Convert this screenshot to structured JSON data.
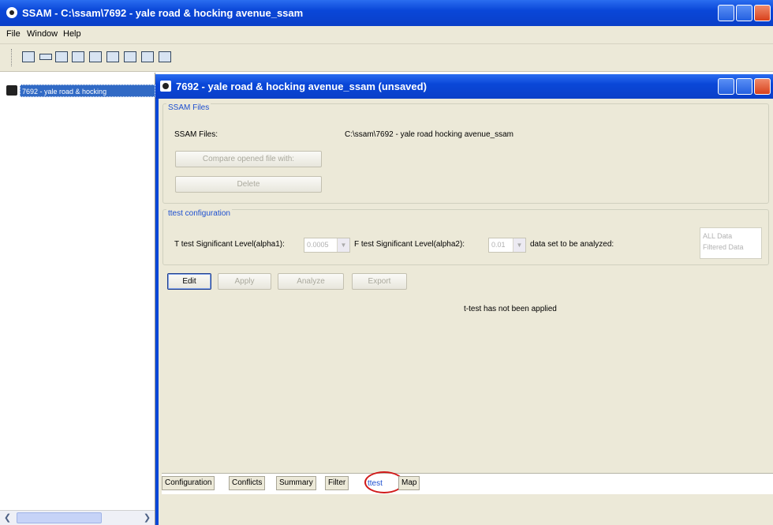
{
  "window": {
    "title": "SSAM - C:\\ssam\\7692 - yale road & hocking avenue_ssam"
  },
  "menu": [
    "File",
    "Window",
    "Help"
  ],
  "toolbar": {
    "icons": [
      "new-file-icon",
      "open-icon",
      "save-icon",
      "copy-icon",
      "tile-horizontal-icon",
      "tile-vertical-icon",
      "grid-icon",
      "cascade-icon",
      "calculator-icon"
    ]
  },
  "tree": {
    "item_label": "7692 - yale road & hocking"
  },
  "child": {
    "title": "7692 - yale road & hocking avenue_ssam (unsaved)"
  },
  "files_group": {
    "title": "SSAM Files",
    "label": "SSAM Files:",
    "value": "C:\\ssam\\7692 - yale road  hocking avenue_ssam",
    "compare_button": "Compare opened file with:",
    "delete_button": "Delete"
  },
  "ttest_group": {
    "title": "ttest configuration",
    "t_label": "T test Significant Level(alpha1):",
    "t_value": "0.0005",
    "f_label": "F test Significant Level(alpha2):",
    "f_value": "0.01",
    "data_label": "data set to be analyzed:",
    "data_options": [
      "ALL Data",
      "Filtered Data"
    ]
  },
  "actions": {
    "edit": "Edit",
    "apply": "Apply",
    "analyze": "Analyze",
    "export": "Export"
  },
  "status": "t-test has not been applied",
  "tabs": [
    "Configuration",
    "Conflicts",
    "Summary",
    "Filter",
    "ttest",
    "Map"
  ],
  "selected_tab": "ttest",
  "colors": {
    "titlebar": "#0a47d8",
    "highlight_circle": "#d01a1a",
    "panel": "#ece9d8"
  }
}
